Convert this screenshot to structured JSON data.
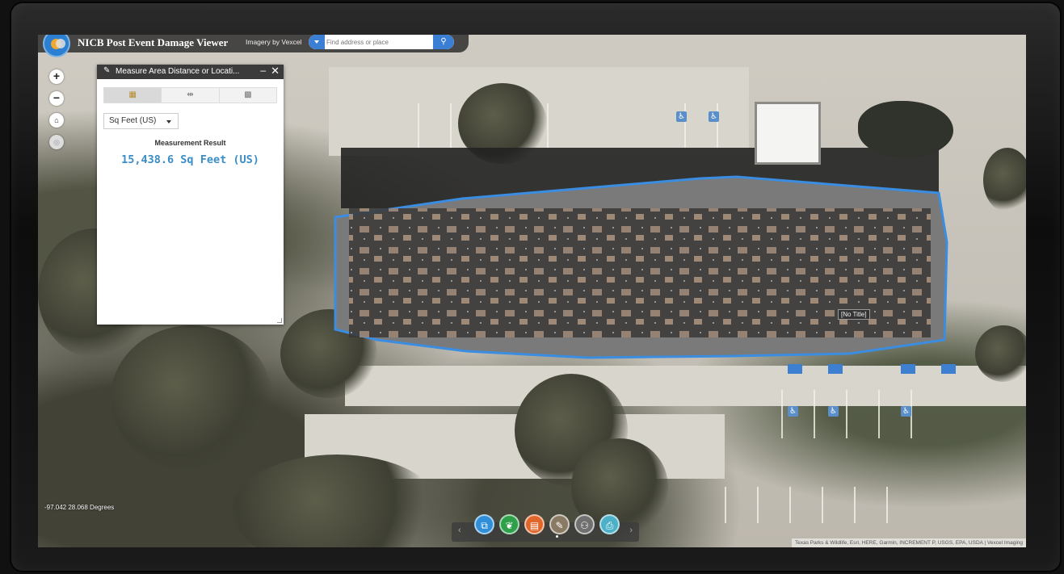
{
  "header": {
    "title": "NICB Post Event Damage Viewer",
    "imagery_credit": "Imagery by Vexcel",
    "search_placeholder": "Find address or place",
    "search_icon": "search-icon"
  },
  "map_controls": {
    "zoom_in": "+",
    "zoom_out": "−",
    "home_icon": "home-icon",
    "locate_icon": "locate-icon"
  },
  "measure_panel": {
    "title": "Measure Area Distance or Locati...",
    "minimize": "–",
    "close": "✕",
    "tools": [
      {
        "name": "area-tool",
        "icon": "area-icon",
        "active": true
      },
      {
        "name": "distance-tool",
        "icon": "distance-icon",
        "active": false
      },
      {
        "name": "location-tool",
        "icon": "location-icon",
        "active": false
      }
    ],
    "unit": "Sq Feet (US)",
    "result_label": "Measurement Result",
    "result_value": "15,438.6 Sq Feet (US)"
  },
  "map": {
    "feature_label": "[No Title]",
    "coordinates": "-97.042 28.068 Degrees",
    "attribution": "Texas Parks & Wildlife, Esri, HERE, Garmin, INCREMENT P, USGS, EPA, USDA | Vexcel Imaging",
    "highlight_color": "#3a8de0"
  },
  "toolbar": {
    "prev": "‹",
    "next": "›",
    "icons": [
      {
        "name": "layers-icon",
        "glyph": "⧉",
        "color": "#2f8fd8"
      },
      {
        "name": "basemap-icon",
        "glyph": "❦",
        "color": "#2fa04a"
      },
      {
        "name": "legend-icon",
        "glyph": "▤",
        "color": "#e0662a"
      },
      {
        "name": "measure-icon",
        "glyph": "✎",
        "color": "#8a7a64"
      },
      {
        "name": "share-icon",
        "glyph": "⚇",
        "color": "#707070"
      },
      {
        "name": "print-icon",
        "glyph": "⎙",
        "color": "#4bb0c8"
      }
    ]
  }
}
